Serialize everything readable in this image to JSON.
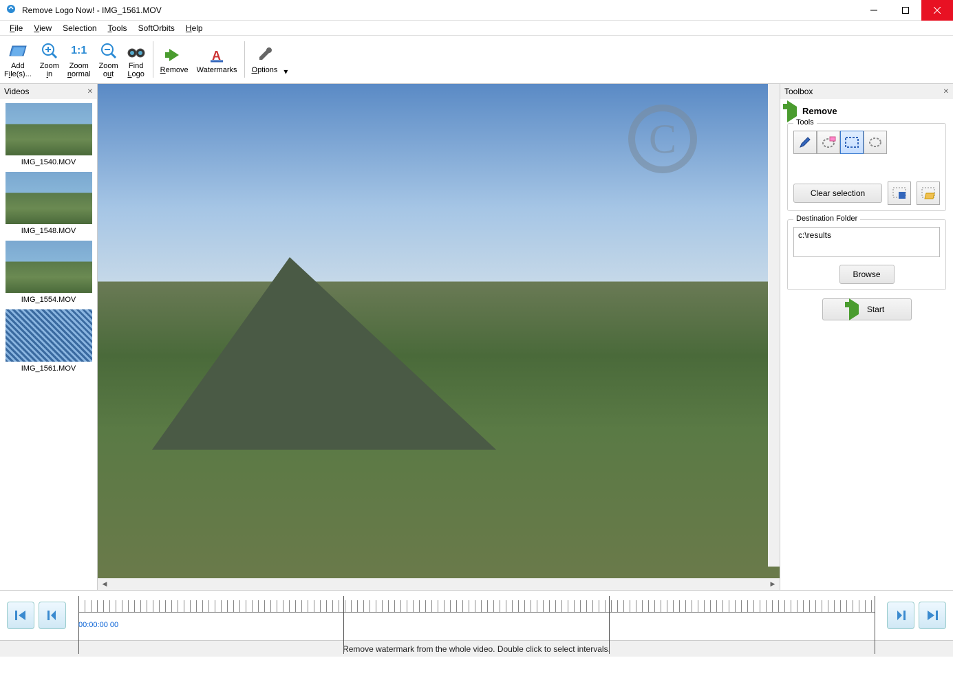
{
  "title": "Remove Logo Now! - IMG_1561.MOV",
  "menu": [
    "File",
    "View",
    "Selection",
    "Tools",
    "SoftOrbits",
    "Help"
  ],
  "toolbar": [
    {
      "id": "add-files",
      "label": "Add\nFile(s)..."
    },
    {
      "id": "zoom-in",
      "label": "Zoom\nin"
    },
    {
      "id": "zoom-normal",
      "label": "Zoom\nnormal",
      "top": "1:1"
    },
    {
      "id": "zoom-out",
      "label": "Zoom\nout"
    },
    {
      "id": "find-logo",
      "label": "Find\nLogo"
    },
    {
      "id": "remove",
      "label": "Remove"
    },
    {
      "id": "watermarks",
      "label": "Watermarks"
    },
    {
      "id": "options",
      "label": "Options"
    }
  ],
  "videos_panel": {
    "title": "Videos",
    "items": [
      {
        "name": "IMG_1540.MOV"
      },
      {
        "name": "IMG_1548.MOV"
      },
      {
        "name": "IMG_1554.MOV"
      },
      {
        "name": "IMG_1561.MOV",
        "selected": true
      }
    ]
  },
  "toolbox": {
    "title": "Toolbox",
    "section_title": "Remove",
    "tools_label": "Tools",
    "clear_selection": "Clear selection",
    "dest_label": "Destination Folder",
    "dest_value": "c:\\results",
    "browse": "Browse",
    "start": "Start"
  },
  "timeline": {
    "current": "00:00:00 00"
  },
  "status": "Remove watermark from the whole video. Double click to select intervals."
}
